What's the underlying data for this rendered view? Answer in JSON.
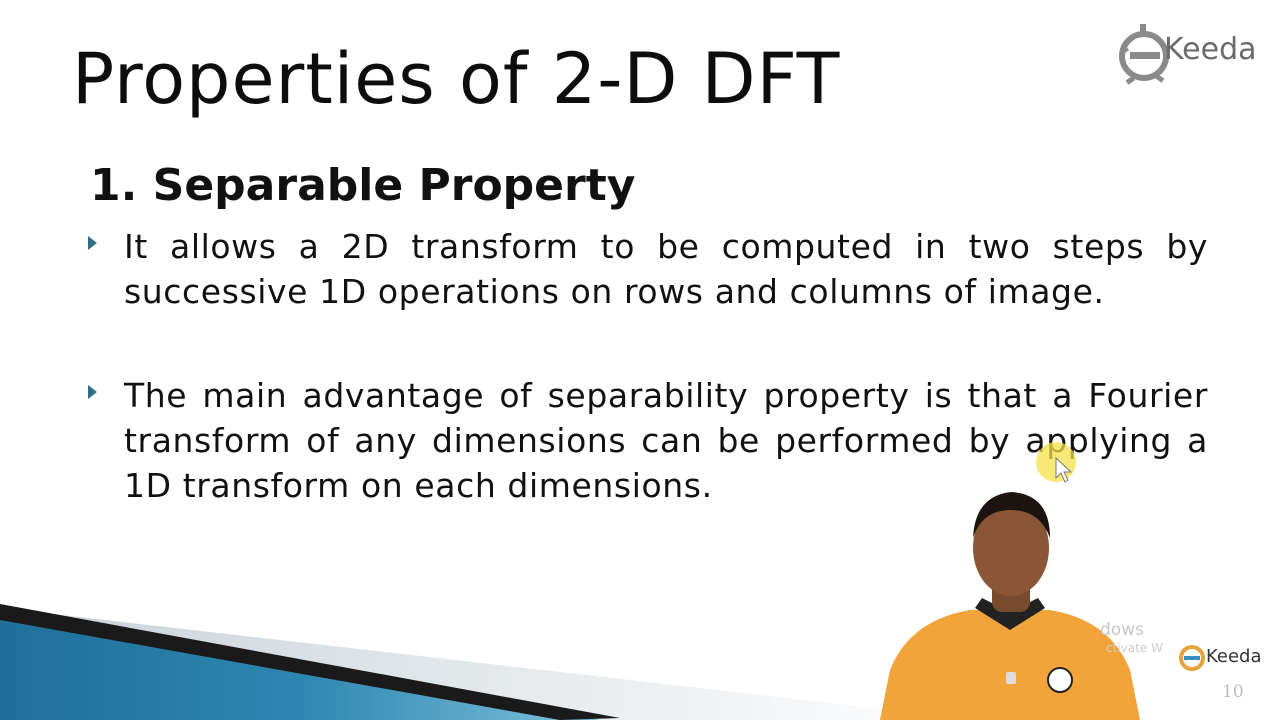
{
  "slide": {
    "title": "Properties of 2-D DFT",
    "logo_text": "Keeda",
    "section_heading": "1. Separable Property",
    "bullets": [
      {
        "text": "It allows a 2D transform to be computed in two steps by successive 1D operations on rows and columns of image."
      },
      {
        "text": "The main advantage of separability property is that a Fourier transform of any dimensions can be performed by applying a 1D transform on each dimensions."
      }
    ],
    "watermark_line1": "dows",
    "watermark_line2": "ctivate W",
    "logo_small_text": "Keeda",
    "page_number": "10"
  },
  "colors": {
    "accent_teal": "#2f6f86",
    "bar_blue": "#2d87b0",
    "shirt_orange": "#f2a43a",
    "cursor_yellow": "#f5e24a"
  },
  "icons": {
    "logo": "ekeeda-logo-icon",
    "bullet": "triangle-right-icon",
    "cursor": "mouse-pointer-icon"
  }
}
